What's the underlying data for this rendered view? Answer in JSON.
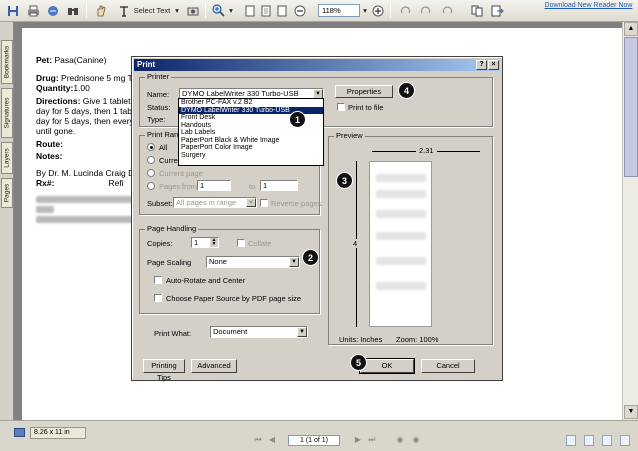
{
  "toolbar": {
    "select_text_label": "Select Text",
    "zoom_value": "118%",
    "download_link": "Download New Reader Now"
  },
  "nav_tabs": [
    "Bookmarks",
    "Signatures",
    "Layers",
    "Pages"
  ],
  "document": {
    "pet_label": "Pet:",
    "pet_value": "Pasa(Canine)",
    "drug_label": "Drug:",
    "drug_value": "Prednisone 5 mg Tal",
    "quantity_label": "Quantity:",
    "quantity_value": "1.00",
    "directions_label": "Directions:",
    "directions_value": "Give 1 tablet t",
    "directions_line2": "day for 5 days, then 1 table",
    "directions_line3": "day for 5 days, then every c",
    "directions_line4": "until gone.",
    "route_label": "Route:",
    "notes_label": "Notes:",
    "doctor": "By Dr. M. Lucinda Craig DV",
    "rx_label": "Rx#:",
    "refill_partial": "Refi"
  },
  "status": {
    "page_size": "8.26 x 11 in",
    "page_field": "1  (1 of 1)"
  },
  "dialog": {
    "title": "Print",
    "help_button": "?",
    "close_button": "×",
    "printer_group": "Printer",
    "name_label": "Name:",
    "name_value": "DYMO LabelWriter 330 Turbo-USB",
    "status_label": "Status:",
    "type_label": "Type:",
    "properties_button": "Properties",
    "print_to_file": "Print to file",
    "printer_options": [
      "Brother PC-FAX v.2 B2",
      "DYMO LabelWriter 330 Turbo-USB",
      "Front Desk",
      "Handouts",
      "Lab Labels",
      "PaperPort Black & White Image",
      "PaperPort Color Image",
      "Surgery"
    ],
    "print_range_group": "Print Rang",
    "all_label": "All",
    "current_view_label": "Curren",
    "current_page_label": "Current page",
    "pages_label": "Pages",
    "from_label": "from",
    "from_value": "1",
    "to_label": "to",
    "to_value": "1",
    "subset_label": "Subset:",
    "subset_value": "All pages in range",
    "reverse_pages": "Reverse pages",
    "page_handling_group": "Page Handling",
    "copies_label": "Copies:",
    "copies_value": "1",
    "collate_label": "Collate",
    "page_scaling_label": "Page Scaling",
    "page_scaling_value": "None",
    "auto_rotate_label": "Auto-Rotate and Center",
    "choose_paper_label": "Choose Paper Source by PDF page size",
    "print_what_label": "Print What:",
    "print_what_value": "Document",
    "preview_group": "Preview",
    "preview_width": "2.31",
    "preview_height": "4",
    "units_label": "Units: Inches",
    "zoom_label": "Zoom: 100%",
    "printing_tips_button": "Printing Tips",
    "advanced_button": "Advanced",
    "ok_button": "OK",
    "cancel_button": "Cancel"
  },
  "callouts": [
    "1",
    "2",
    "3",
    "4",
    "5"
  ]
}
